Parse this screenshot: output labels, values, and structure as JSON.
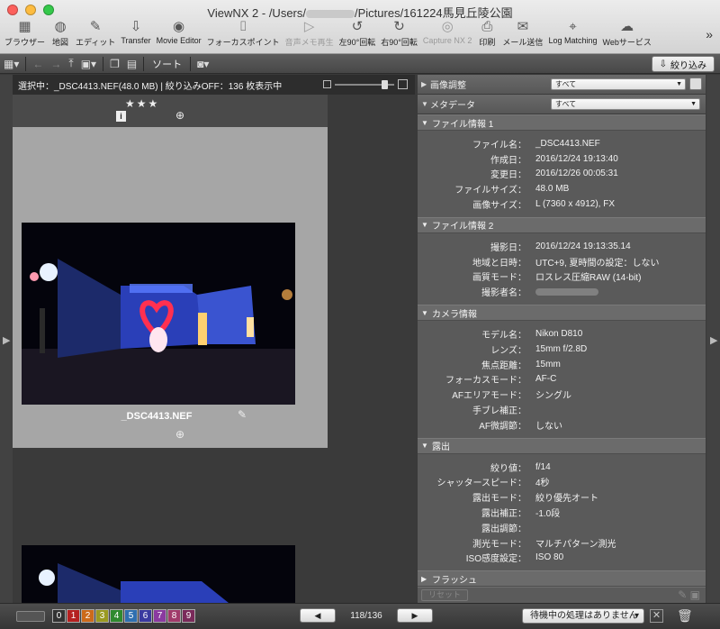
{
  "window": {
    "title_prefix": "ViewNX 2 - /Users/",
    "title_suffix": "/Pictures/161224馬見丘陵公園"
  },
  "toolbar": [
    {
      "id": "browser",
      "label": "ブラウザー",
      "icon": "▦",
      "enabled": true
    },
    {
      "id": "map",
      "label": "地図",
      "icon": "◍",
      "enabled": true
    },
    {
      "id": "edit",
      "label": "エディット",
      "icon": "✎",
      "enabled": true
    },
    {
      "id": "transfer",
      "label": "Transfer",
      "icon": "⇩",
      "enabled": true
    },
    {
      "id": "movie",
      "label": "Movie Editor",
      "icon": "◉",
      "enabled": true
    },
    {
      "id": "focus",
      "label": "フォーカスポイント",
      "icon": "⌷",
      "enabled": true
    },
    {
      "id": "voice",
      "label": "音声メモ再生",
      "icon": "▷",
      "enabled": false
    },
    {
      "id": "rotl",
      "label": "左90°回転",
      "icon": "↺",
      "enabled": true
    },
    {
      "id": "rotr",
      "label": "右90°回転",
      "icon": "↻",
      "enabled": true
    },
    {
      "id": "capture",
      "label": "Capture NX 2",
      "icon": "◎",
      "enabled": false
    },
    {
      "id": "print",
      "label": "印刷",
      "icon": "⎙",
      "enabled": true
    },
    {
      "id": "mail",
      "label": "メール送信",
      "icon": "✉",
      "enabled": true
    },
    {
      "id": "logmatch",
      "label": "Log Matching",
      "icon": "⌖",
      "enabled": true
    },
    {
      "id": "web",
      "label": "Webサービス",
      "icon": "☁",
      "enabled": true
    }
  ],
  "toolbar2": {
    "sort_label": "ソート",
    "filter_label": "絞り込み"
  },
  "status_text": "選択中：_DSC4413.NEF(48.0 MB) | 絞り込みOFF：136 枚表示中",
  "thumb": {
    "rating": "★★★",
    "filename": "_DSC4413.NEF"
  },
  "right": {
    "image_adjust_label": "画像調整",
    "image_adjust_value": "すべて",
    "metadata_label": "メタデータ",
    "metadata_value": "すべて",
    "sections": [
      {
        "title": "ファイル情報 1",
        "rows": [
          {
            "k": "ファイル名：",
            "v": "_DSC4413.NEF"
          },
          {
            "k": "作成日：",
            "v": "2016/12/24 19:13:40"
          },
          {
            "k": "変更日：",
            "v": "2016/12/26 00:05:31"
          },
          {
            "k": "ファイルサイズ：",
            "v": "48.0 MB"
          },
          {
            "k": "画像サイズ：",
            "v": "L (7360 x 4912), FX"
          }
        ]
      },
      {
        "title": "ファイル情報 2",
        "rows": [
          {
            "k": "撮影日：",
            "v": "2016/12/24 19:13:35.14"
          },
          {
            "k": "地域と日時：",
            "v": "UTC+9, 夏時間の設定：しない"
          },
          {
            "k": "画質モード：",
            "v": "ロスレス圧縮RAW (14-bit)"
          },
          {
            "k": "撮影者名：",
            "v": ""
          }
        ]
      },
      {
        "title": "カメラ情報",
        "rows": [
          {
            "k": "モデル名：",
            "v": "Nikon D810"
          },
          {
            "k": "レンズ：",
            "v": "15mm f/2.8D"
          },
          {
            "k": "焦点距離：",
            "v": "15mm"
          },
          {
            "k": "フォーカスモード：",
            "v": "AF-C"
          },
          {
            "k": "AFエリアモード：",
            "v": "シングル"
          },
          {
            "k": "手ブレ補正：",
            "v": ""
          },
          {
            "k": "AF微調節：",
            "v": "しない"
          }
        ]
      },
      {
        "title": "露出",
        "rows": [
          {
            "k": "絞り値：",
            "v": "f/14"
          },
          {
            "k": "シャッタースピード：",
            "v": "4秒"
          },
          {
            "k": "露出モード：",
            "v": "絞り優先オート"
          },
          {
            "k": "露出補正：",
            "v": "-1.0段"
          },
          {
            "k": "露出調節：",
            "v": ""
          },
          {
            "k": "測光モード：",
            "v": "マルチパターン測光"
          },
          {
            "k": "ISO感度設定：",
            "v": "ISO 80"
          }
        ]
      }
    ],
    "flash_label": "フラッシュ",
    "reset_label": "リセット"
  },
  "bottom": {
    "labels": [
      "0",
      "1",
      "2",
      "3",
      "4",
      "5",
      "6",
      "7",
      "8",
      "9"
    ],
    "label_colors": [
      "#333333",
      "#b52020",
      "#cc6a1a",
      "#9a9a20",
      "#2f8a2f",
      "#2f6fb0",
      "#3a3aa0",
      "#8a3aa0",
      "#a03a6a",
      "#7a2a5a"
    ],
    "prev": "◀",
    "next": "▶",
    "page": "118/136",
    "queue": "待機中の処理はありません"
  }
}
